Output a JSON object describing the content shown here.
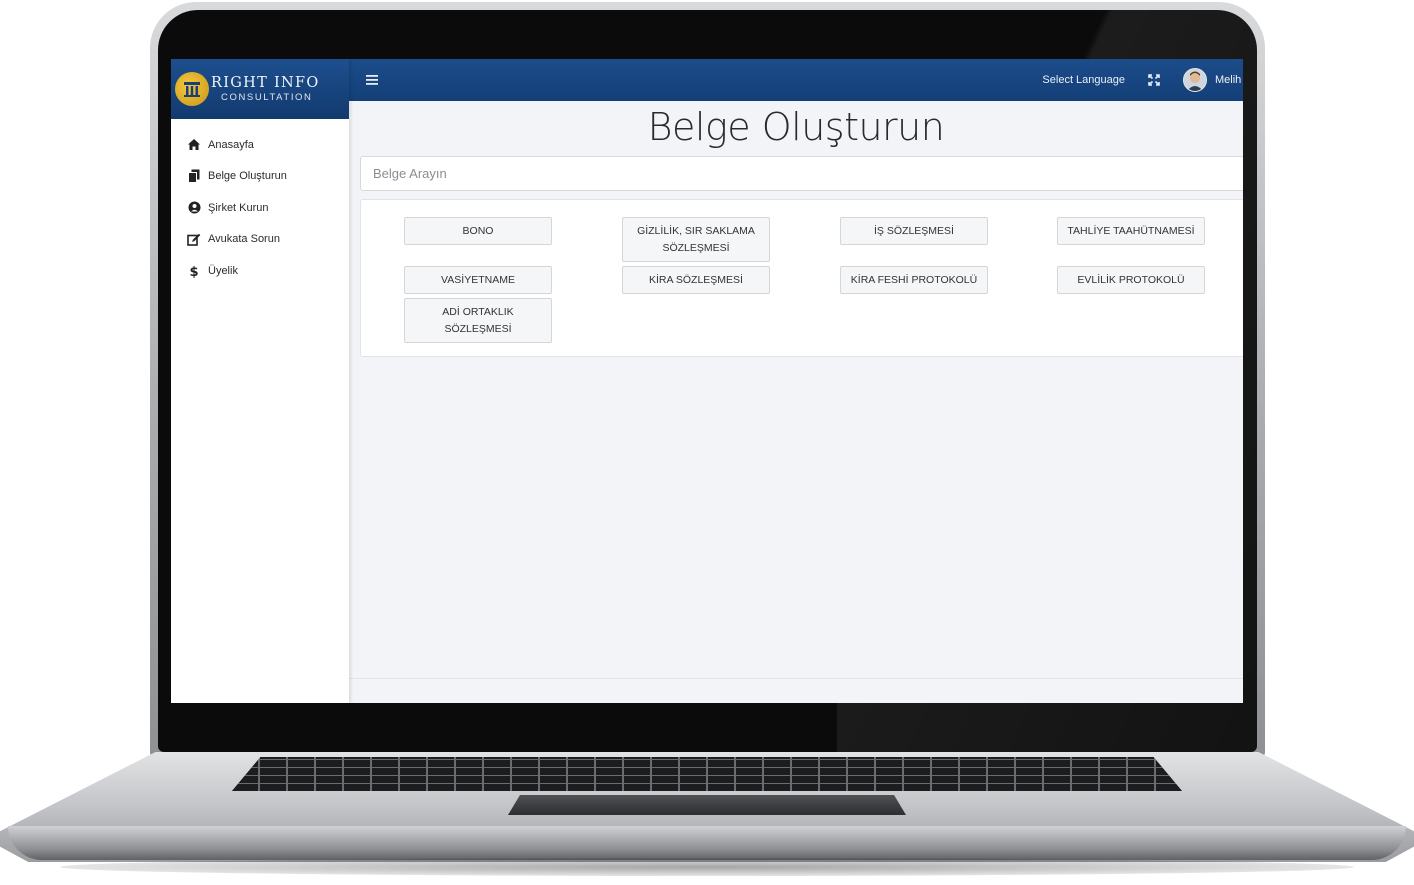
{
  "brand": {
    "title": "RIGHT INFO",
    "subtitle": "CONSULTATION"
  },
  "sidebar": {
    "items": [
      {
        "label": "Anasayfa",
        "icon": "home-icon"
      },
      {
        "label": "Belge Oluşturun",
        "icon": "copy-icon"
      },
      {
        "label": "Şirket Kurun",
        "icon": "user-circle-icon"
      },
      {
        "label": "Avukata Sorun",
        "icon": "edit-icon"
      },
      {
        "label": "Üyelik",
        "icon": "dollar-icon"
      }
    ]
  },
  "topbar": {
    "menu_icon": "hamburger-icon",
    "language_label": "Select Language",
    "fullscreen_icon": "expand-icon",
    "user_name": "Melih"
  },
  "page": {
    "title": "Belge Oluşturun",
    "search_placeholder": "Belge Arayın"
  },
  "documents": [
    {
      "label": "BONO"
    },
    {
      "label": "GİZLİLİK, SIR SAKLAMA SÖZLEŞMESİ"
    },
    {
      "label": "İŞ SÖZLEŞMESİ"
    },
    {
      "label": "TAHLİYE TAAHÜTNAMESİ"
    },
    {
      "label": "VASİYETNAME"
    },
    {
      "label": "KİRA SÖZLEŞMESİ"
    },
    {
      "label": "KİRA FESHİ PROTOKOLÜ"
    },
    {
      "label": "EVLİLİK PROTOKOLÜ"
    },
    {
      "label": "ADİ ORTAKLIK SÖZLEŞMESİ"
    }
  ],
  "colors": {
    "header_blue": "#1c4c8b",
    "logo_gold": "#e6b52a",
    "content_bg": "#f3f4f8",
    "button_bg": "#f5f6f8"
  }
}
